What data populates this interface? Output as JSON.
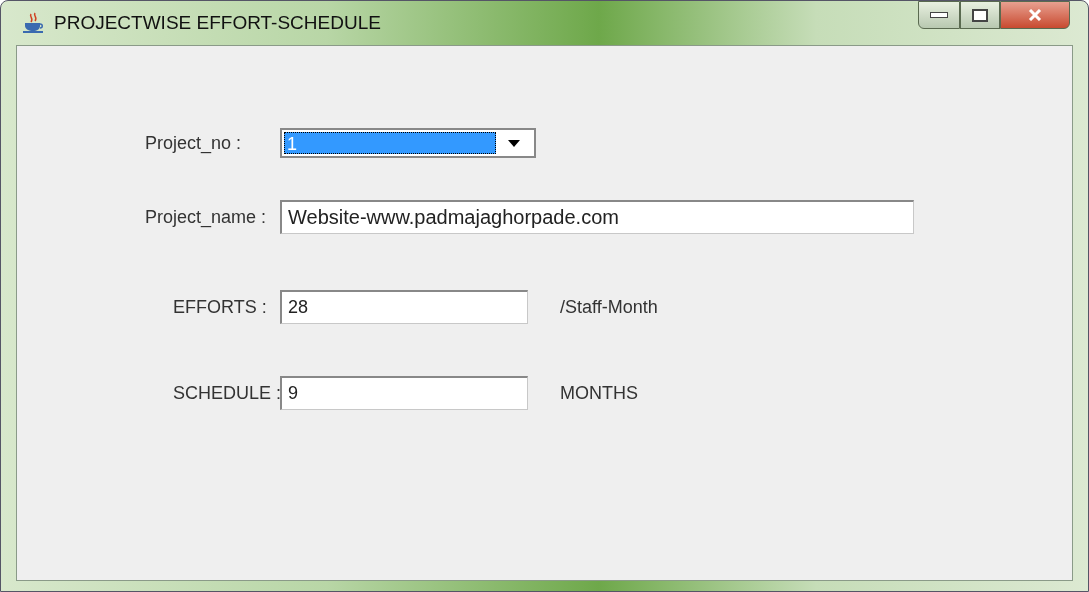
{
  "window": {
    "title": "PROJECTWISE EFFORT-SCHEDULE"
  },
  "form": {
    "project_no": {
      "label": "Project_no :",
      "value": "1",
      "selected": true
    },
    "project_name": {
      "label": "Project_name :",
      "value": "Website-www.padmajaghorpade.com"
    },
    "efforts": {
      "label": "EFFORTS :",
      "value": "28",
      "unit": "/Staff-Month"
    },
    "schedule": {
      "label": "SCHEDULE :",
      "value": "9",
      "unit": "MONTHS"
    }
  }
}
